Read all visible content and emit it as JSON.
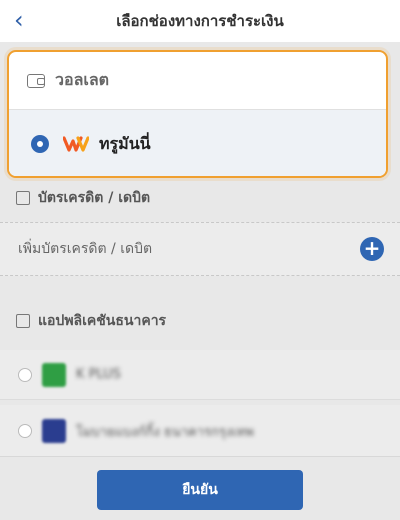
{
  "header": {
    "title": "เลือกช่องทางการชำระเงิน",
    "back_icon": "chevron-left-icon"
  },
  "wallet": {
    "title": "วอลเลต",
    "icon": "wallet-icon",
    "selected_option": "ทรูมันนี่"
  },
  "card_section": {
    "title": "บัตรเครดิต / เดบิต",
    "add_label": "เพิ่มบัตรเครดิต / เดบิต",
    "add_icon": "plus-circle-icon"
  },
  "bank_section": {
    "title": "แอปพลิเคชันธนาคาร",
    "icon": "bank-app-icon",
    "items": [
      "K PLUS",
      "โมบายแบงก์กิ้ง ธนาคารกรุงเทพ"
    ]
  },
  "footer": {
    "confirm_label": "ยืนยัน"
  },
  "colors": {
    "accent": "#2f66b3",
    "highlight": "#f0a030"
  }
}
